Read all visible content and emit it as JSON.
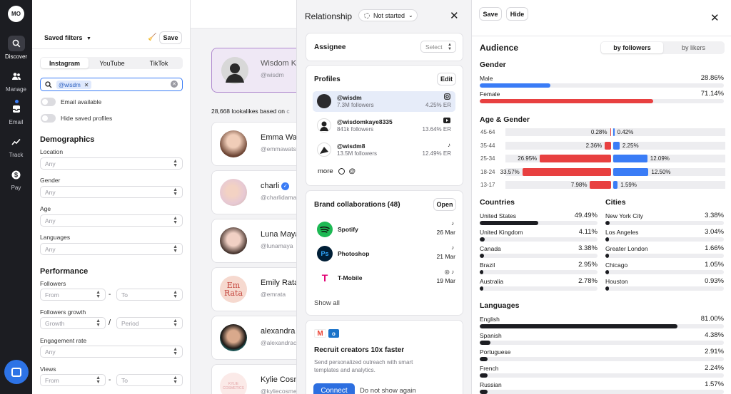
{
  "nav": {
    "logo": "MO",
    "items": [
      {
        "label": "Discover",
        "icon": "search-icon"
      },
      {
        "label": "Manage",
        "icon": "people-icon"
      },
      {
        "label": "Email",
        "icon": "inbox-icon"
      },
      {
        "label": "Track",
        "icon": "chart-icon"
      },
      {
        "label": "Pay",
        "icon": "dollar-icon"
      }
    ]
  },
  "filters": {
    "saved_filters": "Saved filters",
    "save": "Save",
    "platforms": [
      "Instagram",
      "YouTube",
      "TikTok"
    ],
    "search_chip": "@wisdm",
    "toggles": [
      "Email available",
      "Hide saved profiles"
    ],
    "demographics_title": "Demographics",
    "location": {
      "label": "Location",
      "value": "Any"
    },
    "gender": {
      "label": "Gender",
      "value": "Any"
    },
    "age": {
      "label": "Age",
      "value": "Any"
    },
    "languages": {
      "label": "Languages",
      "value": "Any"
    },
    "performance_title": "Performance",
    "followers": {
      "label": "Followers",
      "from": "From",
      "to": "To",
      "sep": "-"
    },
    "followers_growth": {
      "label": "Followers growth",
      "growth": "Growth",
      "period": "Period",
      "sep": "/"
    },
    "engagement": {
      "label": "Engagement rate",
      "value": "Any"
    },
    "views": {
      "label": "Views",
      "from": "From",
      "to": "To",
      "sep": "-"
    }
  },
  "results": {
    "selected": {
      "name": "Wisdom Ka",
      "handle": "@wisdm"
    },
    "lookalikes_text": "28,668 lookalikes based on",
    "lookalikes_suffix": "c",
    "items": [
      {
        "name": "Emma Wat",
        "handle": "@emmawats"
      },
      {
        "name": "charli",
        "handle": "@charlidama"
      },
      {
        "name": "Luna Maya",
        "handle": "@lunamaya"
      },
      {
        "name": "Emily Rataj",
        "handle": "@emrata"
      },
      {
        "name": "alexandra c",
        "handle": "@alexandrac"
      },
      {
        "name": "Kylie Cosm",
        "handle": "@kyliecosme"
      }
    ]
  },
  "profile": {
    "relationship_title": "Relationship",
    "status": "Not started",
    "assignee_title": "Assignee",
    "assignee_select": "Select",
    "profiles_title": "Profiles",
    "edit": "Edit",
    "profiles": [
      {
        "handle": "@wisdm",
        "followers": "7.3M followers",
        "er": "4.25% ER",
        "platform": "instagram-icon"
      },
      {
        "handle": "@wisdomkaye8335",
        "followers": "841k followers",
        "er": "13.64% ER",
        "platform": "youtube-icon"
      },
      {
        "handle": "@wisdm8",
        "followers": "13.5M followers",
        "er": "12.49% ER",
        "platform": "tiktok-icon"
      }
    ],
    "more": "more",
    "brand_title": "Brand collaborations (48)",
    "open": "Open",
    "brands": [
      {
        "name": "Spotify",
        "date": "26 Mar",
        "logo_text": "",
        "color": "#1db954"
      },
      {
        "name": "Photoshop",
        "date": "21 Mar",
        "logo_text": "Ps",
        "color": "#001e36"
      },
      {
        "name": "T-Mobile",
        "date": "19 Mar",
        "logo_text": "T",
        "color": "#e20074"
      }
    ],
    "show_all": "Show all",
    "recruit_title": "Recruit creators 10x faster",
    "recruit_desc_1": "Send personalized outreach with smart",
    "recruit_desc_2": "templates and analytics.",
    "connect": "Connect",
    "dismiss": "Do not show again"
  },
  "audience": {
    "save": "Save",
    "hide": "Hide",
    "title": "Audience",
    "tabs": [
      "by followers",
      "by likers"
    ],
    "gender_title": "Gender",
    "gender": [
      {
        "label": "Male",
        "value": "28.86%",
        "pct": 28.86,
        "color": "#3a7cf6"
      },
      {
        "label": "Female",
        "value": "71.14%",
        "pct": 71.14,
        "color": "#e84040"
      }
    ],
    "age_gender_title": "Age & Gender",
    "age_gender": [
      {
        "range": "45-64",
        "female": "0.28%",
        "female_pct": 0.28,
        "male": "0.42%",
        "male_pct": 0.42
      },
      {
        "range": "35-44",
        "female": "2.36%",
        "female_pct": 2.36,
        "male": "2.25%",
        "male_pct": 2.25
      },
      {
        "range": "25-34",
        "female": "26.95%",
        "female_pct": 26.95,
        "male": "12.09%",
        "male_pct": 12.09
      },
      {
        "range": "18-24",
        "female": "33.57%",
        "female_pct": 33.57,
        "male": "12.50%",
        "male_pct": 12.5
      },
      {
        "range": "13-17",
        "female": "7.98%",
        "female_pct": 7.98,
        "male": "1.59%",
        "male_pct": 1.59
      }
    ],
    "countries_title": "Countries",
    "countries": [
      {
        "label": "United States",
        "value": "49.49%",
        "pct": 49.49
      },
      {
        "label": "United Kingdom",
        "value": "4.11%",
        "pct": 4.11
      },
      {
        "label": "Canada",
        "value": "3.38%",
        "pct": 3.38
      },
      {
        "label": "Brazil",
        "value": "2.95%",
        "pct": 2.95
      },
      {
        "label": "Australia",
        "value": "2.78%",
        "pct": 2.78
      }
    ],
    "cities_title": "Cities",
    "cities": [
      {
        "label": "New York City",
        "value": "3.38%",
        "pct": 3.38
      },
      {
        "label": "Los Angeles",
        "value": "3.04%",
        "pct": 3.04
      },
      {
        "label": "Greater London",
        "value": "1.66%",
        "pct": 1.66
      },
      {
        "label": "Chicago",
        "value": "1.05%",
        "pct": 1.05
      },
      {
        "label": "Houston",
        "value": "0.93%",
        "pct": 0.93
      }
    ],
    "languages_title": "Languages",
    "languages": [
      {
        "label": "English",
        "value": "81.00%",
        "pct": 81.0
      },
      {
        "label": "Spanish",
        "value": "4.38%",
        "pct": 4.38
      },
      {
        "label": "Portuguese",
        "value": "2.91%",
        "pct": 2.91
      },
      {
        "label": "French",
        "value": "2.24%",
        "pct": 2.24
      },
      {
        "label": "Russian",
        "value": "1.57%",
        "pct": 1.57
      }
    ]
  }
}
